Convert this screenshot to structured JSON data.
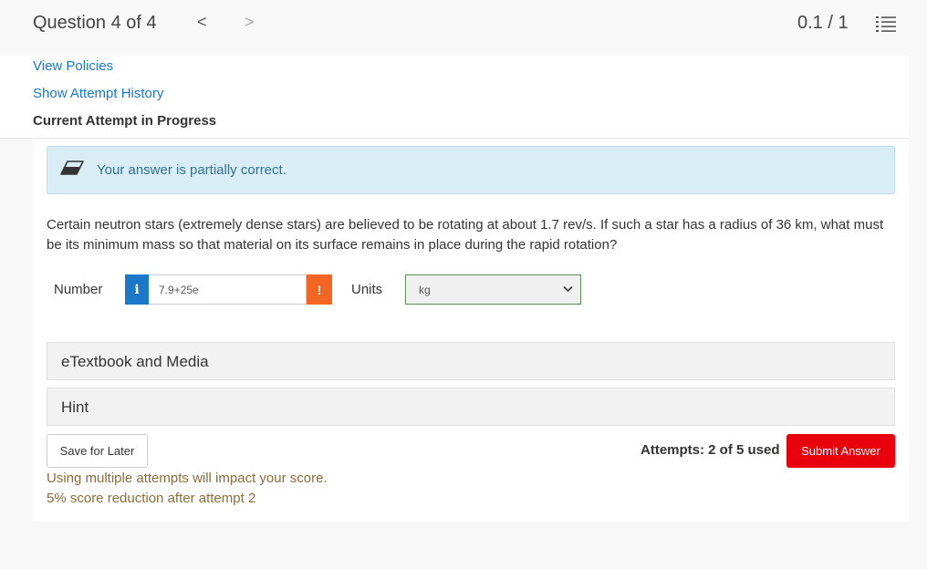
{
  "header": {
    "question_title": "Question 4 of 4",
    "prev_glyph": "<",
    "next_glyph": ">",
    "score": "0.1 / 1",
    "list_icon": "numbered-list-icon"
  },
  "links": {
    "view_policies": "View Policies",
    "attempt_history": "Show Attempt History"
  },
  "attempt_status": "Current Attempt in Progress",
  "feedback": {
    "icon": "eraser-icon",
    "text": "Your answer is partially correct."
  },
  "question": {
    "text": "Certain neutron stars (extremely dense stars) are believed to be rotating at about 1.7 rev/s. If such a star has a radius of 36 km, what must be its minimum mass so that material on its surface remains in place during the rapid rotation?"
  },
  "answer": {
    "number_label": "Number",
    "info_glyph": "i",
    "number_value": "7.9+25e",
    "warn_glyph": "!",
    "units_label": "Units",
    "units_value": "kg"
  },
  "sections": {
    "etextbook": "eTextbook and Media",
    "hint": "Hint"
  },
  "actions": {
    "save_label": "Save for Later",
    "attempts_text": "Attempts: 2 of 5 used",
    "submit_label": "Submit Answer"
  },
  "warnings": {
    "line1": "Using multiple attempts will impact your score.",
    "line2": "5% score reduction after attempt 2"
  },
  "colors": {
    "link": "#1b78c8",
    "feedback_bg": "#d9edf7",
    "submit": "#e8000d",
    "warn_badge": "#f26522",
    "warning_text": "#8a6d3b"
  }
}
